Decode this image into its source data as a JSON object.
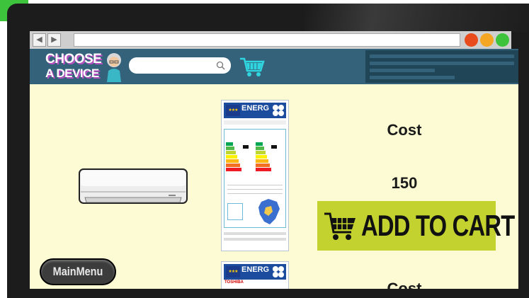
{
  "browser": {
    "back_icon": "back-arrow-icon",
    "forward_icon": "forward-arrow-icon",
    "window_dots": [
      "#e84b1c",
      "#f5a623",
      "#3ec43c"
    ]
  },
  "header": {
    "logo_line1": "CHOOSE",
    "logo_line2": "A DEVICE",
    "search_icon": "search-icon",
    "cart_icon": "shopping-cart-icon"
  },
  "products": [
    {
      "image": "air-conditioner-unit",
      "label_brand": "ENERG",
      "cost_label": "Cost",
      "price": "150",
      "add_to_cart": "ADD TO CART"
    },
    {
      "label_brand": "ENERG",
      "label_maker": "TOSHIBA",
      "cost_label": "Cost"
    }
  ],
  "main_menu": "MainMenu",
  "colors": {
    "header_bg": "#33627a",
    "content_bg": "#fdfbd3",
    "add_to_cart_bg": "#c3d22e",
    "logo_shadow": "#b84fc0"
  }
}
